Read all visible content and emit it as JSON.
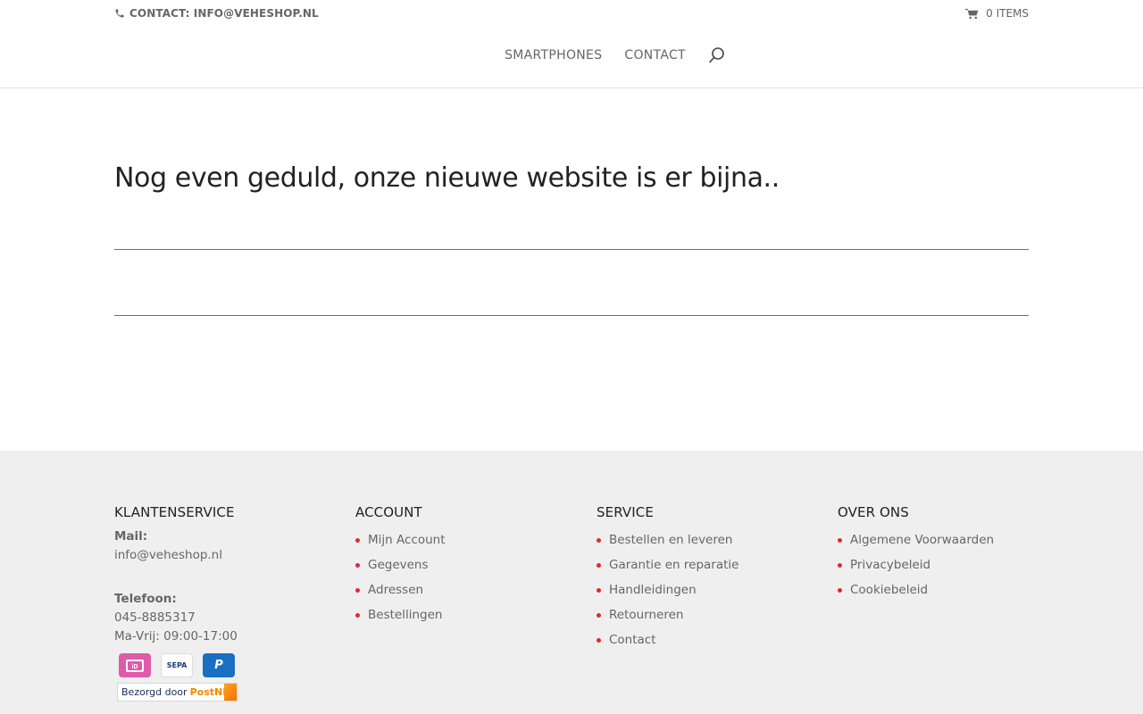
{
  "header": {
    "contact_text": "CONTACT: INFO@VEHESHOP.NL",
    "cart_text": "0 ITEMS",
    "nav": [
      {
        "label": "SMARTPHONES"
      },
      {
        "label": "CONTACT"
      }
    ],
    "icons": {
      "phone": "phone-icon",
      "cart": "cart-icon",
      "search": "search-icon"
    }
  },
  "main": {
    "heading": "Nog even geduld, onze nieuwe website is er bijna.."
  },
  "footer": {
    "klantenservice": {
      "title": "KLANTENSERVICE",
      "mail_label": "Mail:",
      "mail_value": "info@veheshop.nl",
      "phone_label": "Telefoon:",
      "phone_value": "045-8885317",
      "hours": "Ma-Vrij: 09:00-17:00"
    },
    "account": {
      "title": "ACCOUNT",
      "items": [
        "Mijn Account",
        "Gegevens",
        "Adressen",
        "Bestellingen"
      ]
    },
    "service": {
      "title": "SERVICE",
      "items": [
        "Bestellen en leveren",
        "Garantie en reparatie",
        "Handleidingen",
        "Retourneren",
        "Contact"
      ]
    },
    "over_ons": {
      "title": "OVER ONS",
      "items": [
        "Algemene Voorwaarden",
        "Privacybeleid",
        "Cookiebeleid"
      ]
    },
    "payments": {
      "ideal": "iD",
      "sepa": "SEPA",
      "paypal": "P",
      "postnl_prefix": "Bezorgd door",
      "postnl_brand": "PostNL"
    }
  },
  "colors": {
    "accent": "#c2456b",
    "bullet": "#e0292f",
    "footer_bg": "#efefef",
    "heading": "#222222",
    "text": "#666666"
  }
}
